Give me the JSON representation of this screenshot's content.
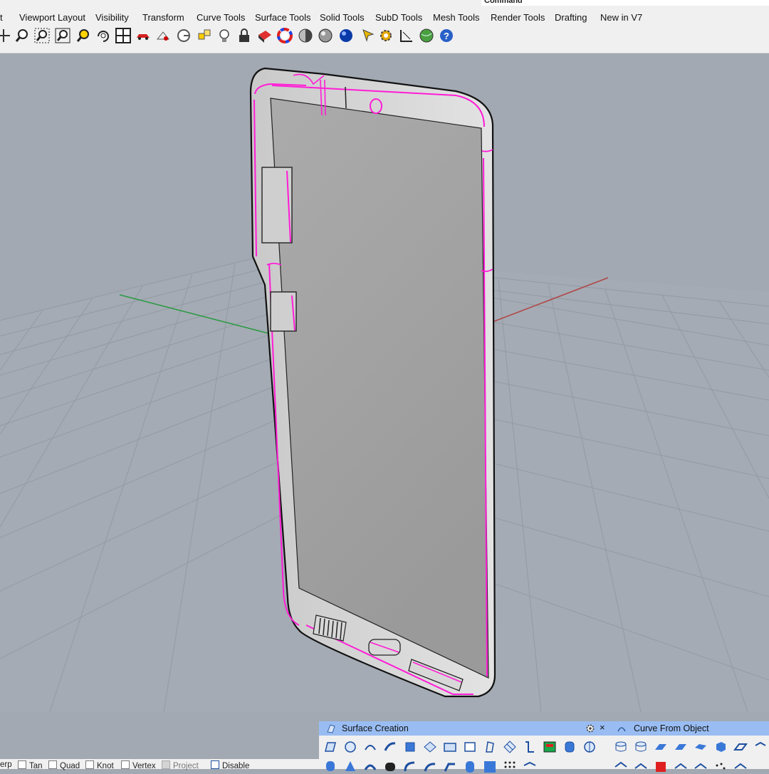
{
  "command_label": "Command",
  "tabs": [
    "t",
    "Viewport Layout",
    "Visibility",
    "Transform",
    "Curve Tools",
    "Surface Tools",
    "Solid Tools",
    "SubD Tools",
    "Mesh Tools",
    "Render Tools",
    "Drafting",
    "New in V7"
  ],
  "panels": {
    "surface_creation": {
      "title": "Surface Creation",
      "close": "×"
    },
    "curve_from_object": {
      "title": "Curve From Object"
    }
  },
  "status_bar": {
    "snaps": [
      {
        "label": "erp",
        "checked": false
      },
      {
        "label": "Tan",
        "checked": false
      },
      {
        "label": "Quad",
        "checked": false
      },
      {
        "label": "Knot",
        "checked": false
      },
      {
        "label": "Vertex",
        "checked": false
      },
      {
        "label": "Project",
        "checked": false
      },
      {
        "label": "Disable",
        "checked": false
      }
    ]
  },
  "colors": {
    "viewport_bg": "#a2a9b2",
    "grid_line": "#8e959f",
    "x_axis": "#b04848",
    "y_axis": "#2c9a44",
    "selection": "#ff1dd6",
    "panel_header": "#99bdf3"
  },
  "icons": [
    "zoom-icon",
    "zoom-window-icon",
    "zoom-extents-icon",
    "zoom-selected-icon",
    "rotate-view-icon",
    "four-viewports-icon",
    "car-icon",
    "named-view-icon",
    "options-icon",
    "layer-icon",
    "light-icon",
    "lock-icon",
    "material-icon",
    "color-wheel-icon",
    "shaded-sphere-icon",
    "rendered-sphere-icon",
    "blue-sphere-icon",
    "pointer-icon",
    "gear-icon",
    "dimension-icon",
    "globe-icon",
    "help-icon"
  ]
}
